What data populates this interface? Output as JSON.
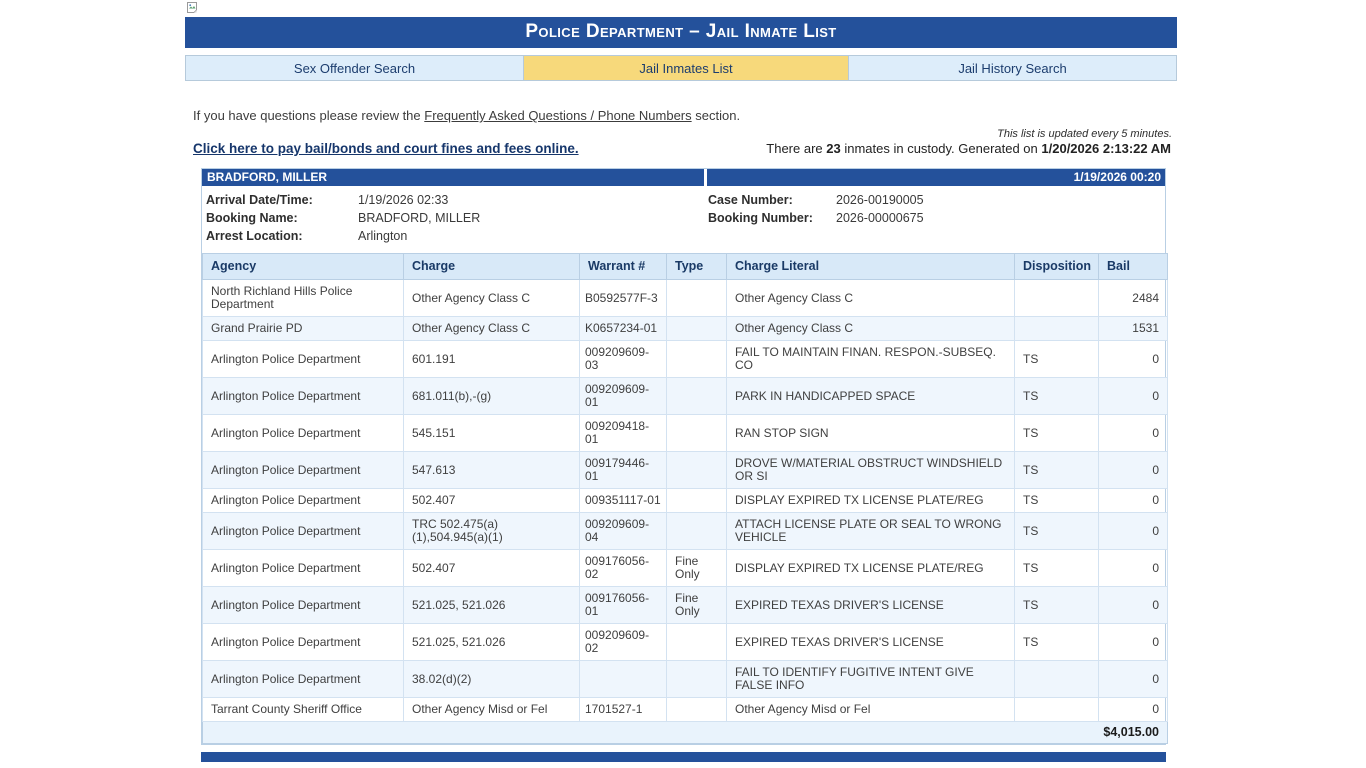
{
  "page": {
    "title": "Police Department – Jail Inmate List",
    "tabs": [
      {
        "label": "Sex Offender Search",
        "active": false
      },
      {
        "label": "Jail Inmates List",
        "active": true
      },
      {
        "label": "Jail History Search",
        "active": false
      }
    ],
    "faq_prefix": "If you have questions please review the ",
    "faq_link": "Frequently Asked Questions / Phone Numbers",
    "faq_suffix": " section.",
    "updated_note": "This list is updated every 5 minutes.",
    "pay_link": "Click here to pay bail/bonds and court fines and fees online.",
    "custody_prefix": "There are ",
    "custody_count": "23",
    "custody_mid": " inmates in custody. Generated on ",
    "custody_timestamp": "1/20/2026 2:13:22 AM"
  },
  "inmate": {
    "name": "BRADFORD, MILLER",
    "header_datetime": "1/19/2026  00:20",
    "details_left": [
      {
        "label": "Arrival Date/Time:",
        "value": "1/19/2026 02:33"
      },
      {
        "label": "Booking Name:",
        "value": "BRADFORD, MILLER"
      },
      {
        "label": "Arrest Location:",
        "value": "Arlington"
      }
    ],
    "details_right": [
      {
        "label": "Case Number:",
        "value": "2026-00190005"
      },
      {
        "label": "Booking Number:",
        "value": "2026-00000675"
      }
    ],
    "charges_table": {
      "columns": [
        "Agency",
        "Charge",
        "Warrant #",
        "Type",
        "Charge Literal",
        "Disposition",
        "Bail"
      ],
      "rows": [
        [
          "North Richland Hills Police Department",
          "Other Agency Class C",
          "B0592577F-3",
          "",
          "Other Agency Class C",
          "",
          "2484"
        ],
        [
          "Grand Prairie PD",
          "Other Agency Class C",
          "K0657234-01",
          "",
          "Other Agency Class C",
          "",
          "1531"
        ],
        [
          "Arlington Police Department",
          "601.191",
          "009209609-03",
          "",
          "FAIL TO MAINTAIN FINAN. RESPON.-SUBSEQ. CO",
          "TS",
          "0"
        ],
        [
          "Arlington Police Department",
          "681.011(b),-(g)",
          "009209609-01",
          "",
          "PARK IN HANDICAPPED SPACE",
          "TS",
          "0"
        ],
        [
          "Arlington Police Department",
          "545.151",
          "009209418-01",
          "",
          "RAN STOP SIGN",
          "TS",
          "0"
        ],
        [
          "Arlington Police Department",
          "547.613",
          "009179446-01",
          "",
          "DROVE W/MATERIAL OBSTRUCT WINDSHIELD OR SI",
          "TS",
          "0"
        ],
        [
          "Arlington Police Department",
          "502.407",
          "009351117-01",
          "",
          "DISPLAY EXPIRED TX LICENSE PLATE/REG",
          "TS",
          "0"
        ],
        [
          "Arlington Police Department",
          "TRC 502.475(a)(1),504.945(a)(1)",
          "009209609-04",
          "",
          "ATTACH LICENSE PLATE OR SEAL TO WRONG VEHICLE",
          "TS",
          "0"
        ],
        [
          "Arlington Police Department",
          "502.407",
          "009176056-02",
          "Fine Only",
          "DISPLAY EXPIRED TX LICENSE PLATE/REG",
          "TS",
          "0"
        ],
        [
          "Arlington Police Department",
          "521.025, 521.026",
          "009176056-01",
          "Fine Only",
          "EXPIRED TEXAS DRIVER'S LICENSE",
          "TS",
          "0"
        ],
        [
          "Arlington Police Department",
          "521.025, 521.026",
          "009209609-02",
          "",
          "EXPIRED TEXAS DRIVER'S LICENSE",
          "TS",
          "0"
        ],
        [
          "Arlington Police Department",
          "38.02(d)(2)",
          "",
          "",
          "FAIL TO IDENTIFY FUGITIVE INTENT GIVE FALSE INFO",
          "",
          "0"
        ],
        [
          "Tarrant County Sheriff Office",
          "Other Agency Misd or Fel",
          "1701527-1",
          "",
          "Other Agency Misd or Fel",
          "",
          "0"
        ]
      ],
      "total": "$4,015.00"
    }
  },
  "colors": {
    "header_blue": "#24519B",
    "tab_active_yellow": "#F7D97B",
    "tab_inactive_blue": "#DDEDFA",
    "table_header_bg": "#D8E9F8",
    "row_alt_bg": "#EFF6FD",
    "total_row_bg": "#E9F3FC",
    "link_navy": "#16366B"
  },
  "icons": {
    "broken_image": "broken-image-icon"
  }
}
